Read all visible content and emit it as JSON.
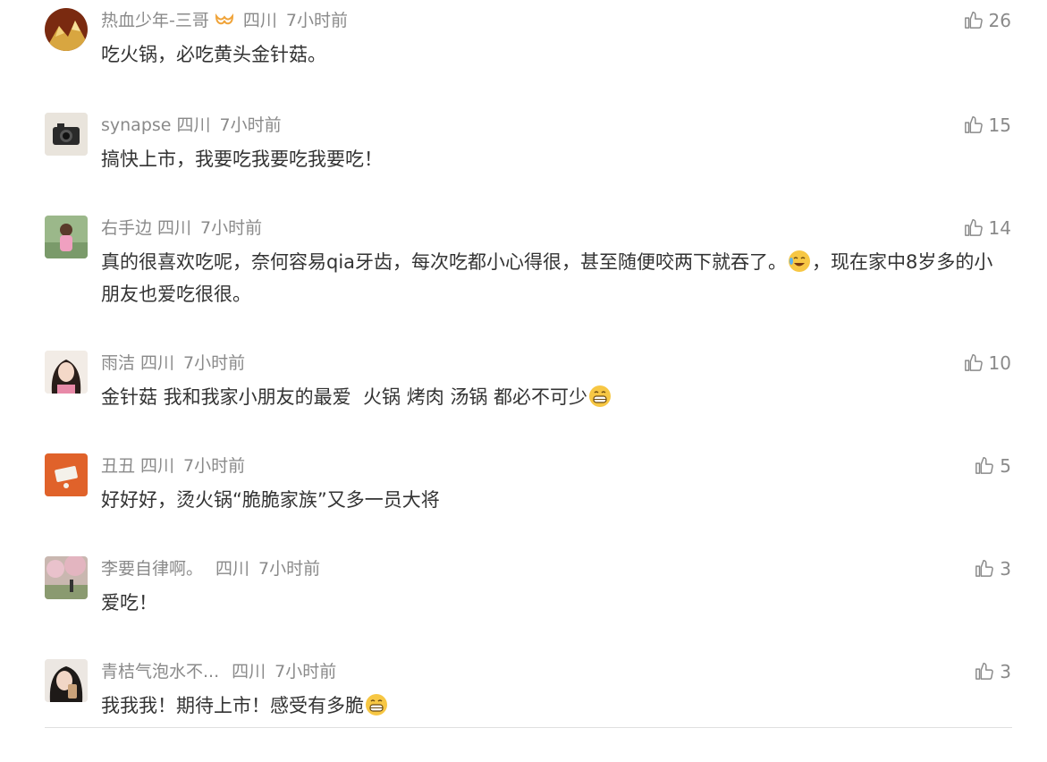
{
  "comments": [
    {
      "name": "热血少年-三哥",
      "location": "四川",
      "time": "7小时前",
      "text": "吃火锅，必吃黄头金针菇。",
      "likes": "26",
      "avatar": "mountain-avatar"
    },
    {
      "name": "synapse",
      "location": "四川",
      "time": "7小时前",
      "text": "搞快上市，我要吃我要吃我要吃！",
      "likes": "15",
      "avatar": "camera-avatar"
    },
    {
      "name": "右手边",
      "location": "四川",
      "time": "7小时前",
      "text_a": "真的很喜欢吃呢，奈何容易qia牙齿，每次吃都小心得很，甚至随便咬两下就吞了。",
      "text_b": "，现在家中8岁多的小朋友也爱吃很很。",
      "likes": "14",
      "avatar": "child-avatar"
    },
    {
      "name": "雨洁",
      "location": "四川",
      "time": "7小时前",
      "text": "金针菇 我和我家小朋友的最爱  火锅 烤肉 汤锅 都必不可少",
      "likes": "10",
      "avatar": "girl-avatar"
    },
    {
      "name": "丑丑",
      "location": "四川",
      "time": "7小时前",
      "text": "好好好，烫火锅“脆脆家族”又多一员大将",
      "likes": "5",
      "avatar": "orange-avatar"
    },
    {
      "name": "李要自律啊。",
      "location": "四川",
      "time": "7小时前",
      "text": "爱吃！",
      "likes": "3",
      "avatar": "blossom-avatar"
    },
    {
      "name": "青桔气泡水不...",
      "location": "四川",
      "time": "7小时前",
      "text": "我我我！期待上市！感受有多脆",
      "likes": "3",
      "avatar": "drink-avatar"
    }
  ]
}
